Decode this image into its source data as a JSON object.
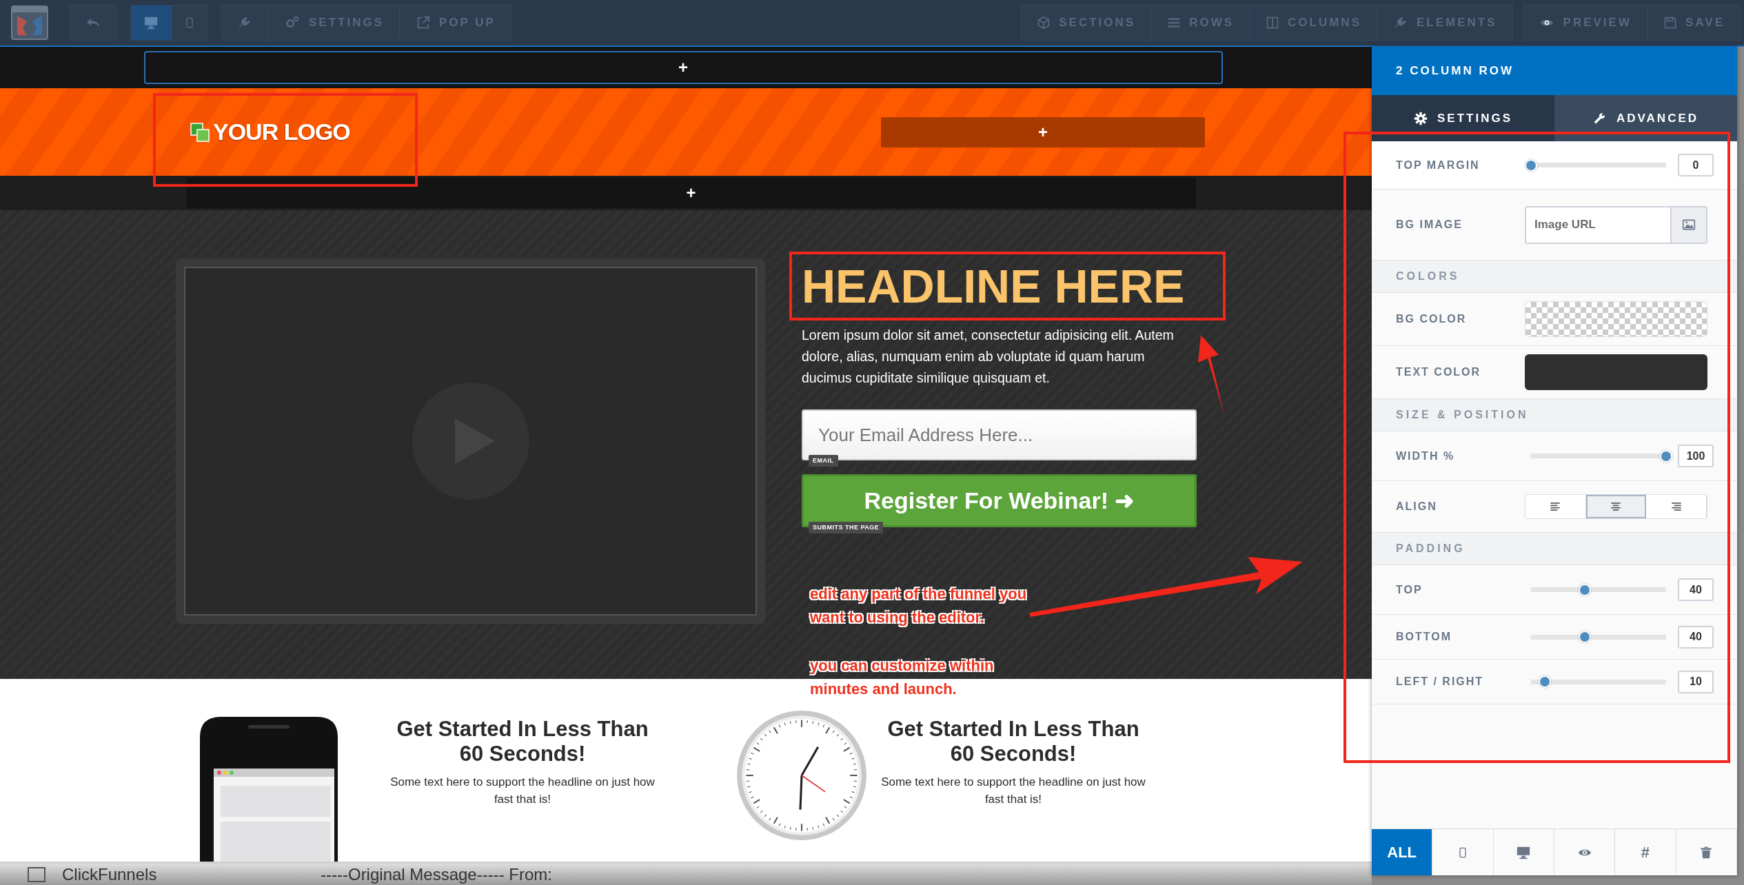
{
  "toolbar": {
    "view_toggle": [
      {
        "selected": true
      },
      {
        "selected": false
      }
    ],
    "left_actions": [
      {
        "label": "SETTINGS"
      },
      {
        "label": "POP UP"
      }
    ],
    "right_actions": [
      {
        "label": "SECTIONS"
      },
      {
        "label": "ROWS"
      },
      {
        "label": "COLUMNS"
      },
      {
        "label": "ELEMENTS"
      },
      {
        "label": "PREVIEW"
      },
      {
        "label": "SAVE"
      }
    ]
  },
  "canvas": {
    "add_buttons": [
      {
        "label": "+"
      },
      {
        "label": "+"
      },
      {
        "label": "+"
      }
    ],
    "header": {
      "logo": "YOUR LOGO"
    },
    "hero": {
      "headline": "HEADLINE HERE",
      "paragraph": "Lorem ipsum dolor sit amet, consectetur adipisicing elit. Autem dolore, alias, numquam enim ab voluptate id quam harum ducimus cupiditate similique quisquam et.",
      "email": {
        "placeholder": "Your Email Address Here...",
        "tag": "EMAIL"
      },
      "button": {
        "label": "Register For Webinar!",
        "icon": "➜",
        "tag": "SUBMITS THE PAGE"
      }
    },
    "features": [
      {
        "kind": "phone",
        "title": "Get Started In Less Than 60 Seconds!",
        "text": "Some text here to support the headline on just how fast that is!"
      },
      {
        "kind": "clock",
        "title": "Get Started In Less Than 60 Seconds!",
        "text": "Some text here to support the headline on just how fast that is!"
      }
    ],
    "annotations": [
      "edit any part of the funnel you want to using the editor.",
      "you can customize within minutes and launch."
    ]
  },
  "panel": {
    "title": "2 COLUMN ROW",
    "tabs": [
      {
        "label": "SETTINGS",
        "selected": true
      },
      {
        "label": "ADVANCED",
        "selected": false
      }
    ],
    "rows": [
      {
        "kind": "slider",
        "label": "TOP MARGIN",
        "level": 0,
        "value": "0"
      },
      {
        "kind": "image",
        "label": "BG IMAGE",
        "placeholder": "Image URL"
      },
      {
        "kind": "header",
        "label": "COLORS"
      },
      {
        "kind": "checker",
        "label": "BG COLOR"
      },
      {
        "kind": "swatch",
        "label": "TEXT COLOR",
        "color": "#2f2f2f"
      },
      {
        "kind": "header",
        "label": "SIZE & POSITION"
      },
      {
        "kind": "slider",
        "label": "WIDTH %",
        "level": 1,
        "value": "100"
      },
      {
        "kind": "align",
        "label": "ALIGN",
        "options": [
          {
            "selected": false
          },
          {
            "selected": true
          },
          {
            "selected": false
          }
        ]
      },
      {
        "kind": "header",
        "label": "PADDING"
      },
      {
        "kind": "slider",
        "label": "TOP",
        "level": 0.4,
        "value": "40"
      },
      {
        "kind": "slider",
        "label": "BOTTOM",
        "level": 0.4,
        "value": "40"
      },
      {
        "kind": "slider",
        "label": "LEFT / RIGHT",
        "level": 0.1,
        "value": "10"
      }
    ],
    "footer_tabs": [
      {
        "label": "ALL",
        "selected": true
      },
      {
        "selected": false
      },
      {
        "selected": false
      },
      {
        "selected": false
      },
      {
        "label": "#",
        "selected": false
      },
      {
        "selected": false
      }
    ]
  },
  "background_window": {
    "checked": false,
    "texts": [
      "ClickFunnels",
      "-----Original Message----- From:"
    ]
  }
}
